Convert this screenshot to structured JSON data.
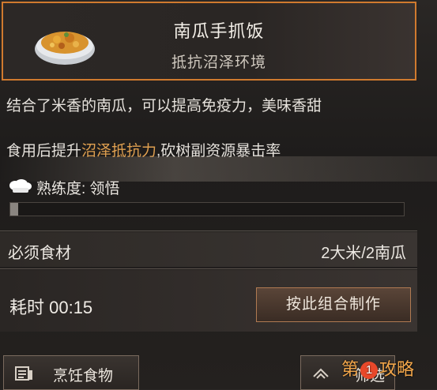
{
  "recipe": {
    "title": "南瓜手抓饭",
    "subtitle": "抵抗沼泽环境",
    "description": "结合了米香的南瓜，可以提高免疫力，美味香甜",
    "effect_prefix": "食用后提升",
    "effect_highlight": "沼泽抵抗力",
    "effect_suffix": ",砍树副资源暴击率",
    "icon": "pumpkin-rice-bowl-icon"
  },
  "proficiency": {
    "label": "熟练度: 领悟",
    "progress": 0.02,
    "icon": "chef-hat-icon"
  },
  "ingredients": {
    "label": "必须食材",
    "value": "2大米/2南瓜"
  },
  "timing": {
    "label": "耗时 00:15"
  },
  "buttons": {
    "craft": "按此组合制作",
    "cook": "烹饪食物",
    "filter": "筛选"
  },
  "watermark": {
    "text_a": "第",
    "num": "1",
    "text_b": "攻略"
  },
  "colors": {
    "accent_border": "#d07a2e",
    "highlight_text": "#e0a050"
  }
}
